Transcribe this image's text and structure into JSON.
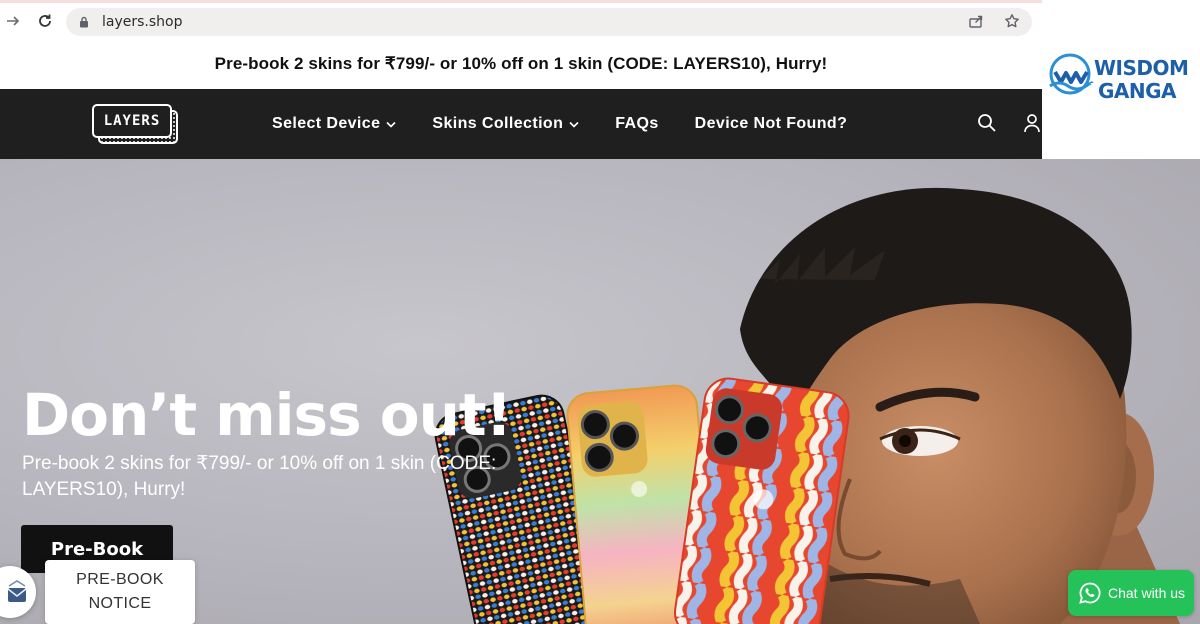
{
  "browser": {
    "url": "layers.shop"
  },
  "watermark": {
    "line1": "WISDOM",
    "line2": "GANGA"
  },
  "announcement": {
    "text": "Pre-book 2 skins for ₹799/- or 10% off on 1 skin (CODE: LAYERS10), Hurry!"
  },
  "header": {
    "logo_text": "LAYERS",
    "menu": [
      {
        "label": "Select Device",
        "has_dropdown": true
      },
      {
        "label": "Skins Collection",
        "has_dropdown": true
      },
      {
        "label": "FAQs",
        "has_dropdown": false
      },
      {
        "label": "Device Not Found?",
        "has_dropdown": false
      }
    ],
    "icons": [
      "search-icon",
      "account-icon"
    ]
  },
  "hero": {
    "title": "Don’t miss out!",
    "subtitle": "Pre-book 2 skins for ₹799/- or 10% off on 1 skin (CODE: LAYERS10), Hurry!",
    "cta_label": "Pre-Book"
  },
  "overlays": {
    "notice_line1": "PRE-BOOK",
    "notice_line2": "NOTICE",
    "chat_label": "Chat with us"
  },
  "colors": {
    "header_bg": "#1f1f20",
    "cta_bg": "#111111",
    "whatsapp_green": "#25c25a",
    "watermark_blue": "#1d5fa8"
  }
}
